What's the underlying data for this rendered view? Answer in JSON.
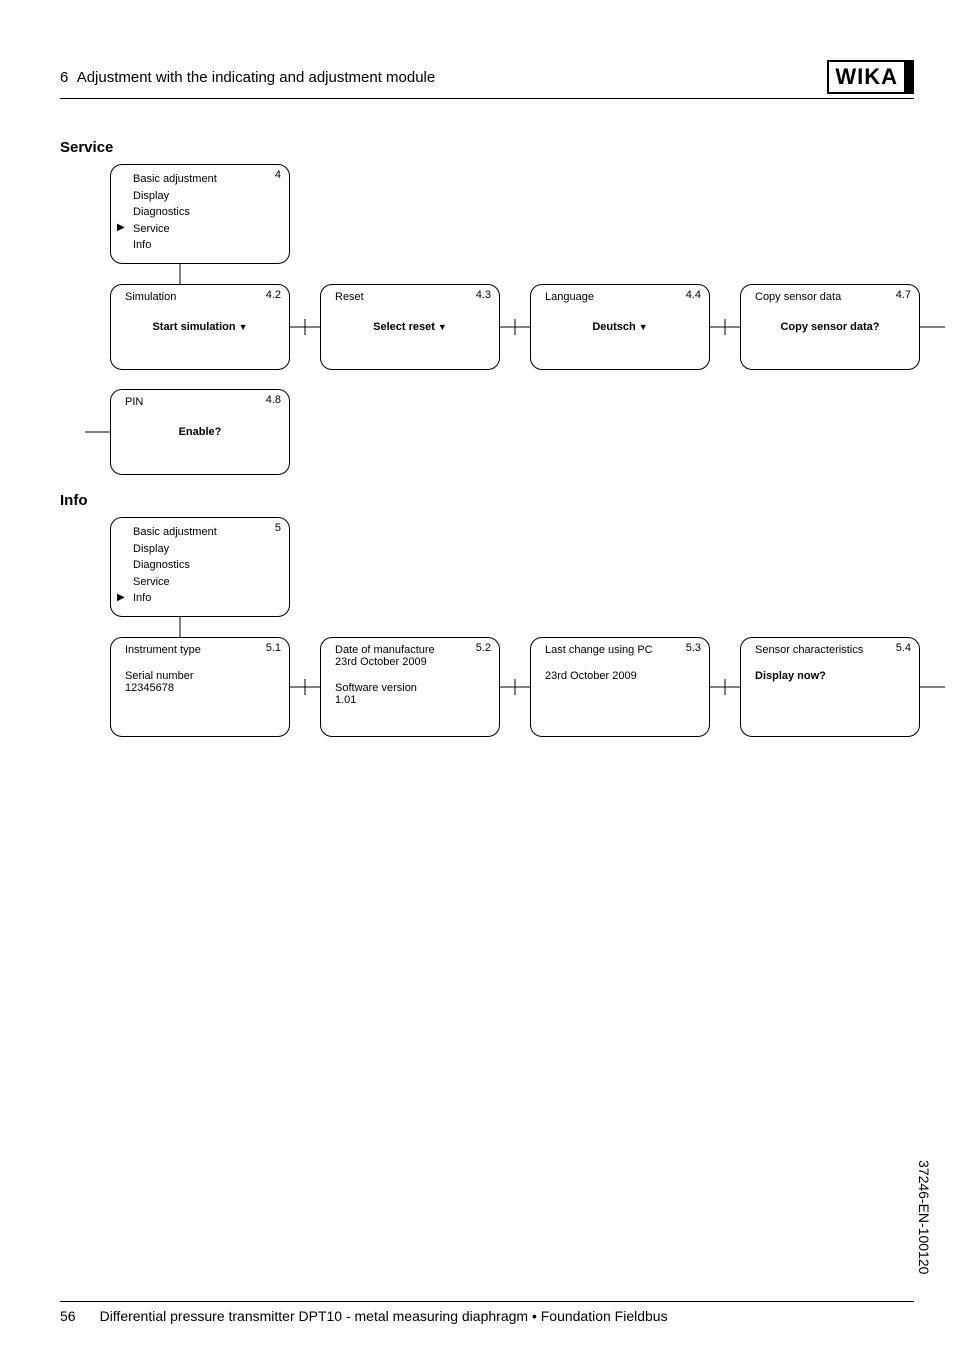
{
  "header": {
    "chapter_num": "6",
    "chapter_title": "Adjustment with the indicating and adjustment module",
    "logo": "WIKA"
  },
  "service": {
    "title": "Service",
    "menu": {
      "num": "4",
      "items": [
        "Basic adjustment",
        "Display",
        "Diagnostics",
        "Service",
        "Info"
      ],
      "selected_index": 3
    },
    "boxes": [
      {
        "num": "4.2",
        "title": "Simulation",
        "action": "Start simulation"
      },
      {
        "num": "4.3",
        "title": "Reset",
        "action": "Select reset"
      },
      {
        "num": "4.4",
        "title": "Language",
        "action": "Deutsch"
      },
      {
        "num": "4.7",
        "title": "Copy sensor data",
        "action_plain": "Copy sensor data?"
      },
      {
        "num": "4.8",
        "title": "PIN",
        "action_plain": "Enable?"
      }
    ]
  },
  "info": {
    "title": "Info",
    "menu": {
      "num": "5",
      "items": [
        "Basic adjustment",
        "Display",
        "Diagnostics",
        "Service",
        "Info"
      ],
      "selected_index": 4
    },
    "boxes": [
      {
        "num": "5.1",
        "l1": "Instrument type",
        "l3": "Serial number",
        "l4": "12345678"
      },
      {
        "num": "5.2",
        "l1": "Date of manufacture",
        "l2": "23rd October 2009",
        "l3": "Software version",
        "l4": "1.01"
      },
      {
        "num": "5.3",
        "l1": "Last change using PC",
        "l2b": "23rd October 2009"
      },
      {
        "num": "5.4",
        "l1": "Sensor characteristics",
        "action_plain": "Display now?"
      }
    ]
  },
  "footer": {
    "page": "56",
    "text": "Differential pressure transmitter DPT10 - metal measuring diaphragm • Foundation Fieldbus"
  },
  "doc_code": "37246-EN-100120"
}
